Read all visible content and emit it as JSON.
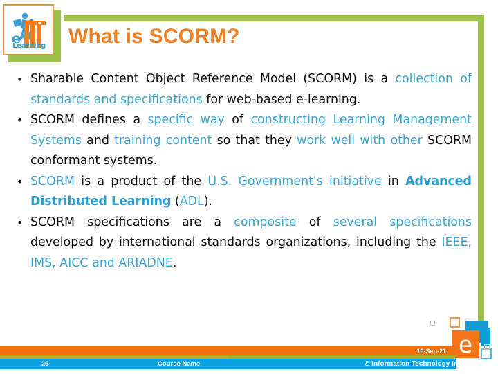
{
  "slide": {
    "title": "What is SCORM?",
    "accent_orange": "#ef7f22",
    "accent_green": "#9dc249",
    "accent_blue": "#3aa6d8"
  },
  "logo": {
    "name": "eITI Learning",
    "mark_e": "e",
    "mark_learning": "Learning"
  },
  "bullets": [
    {
      "runs": [
        {
          "text": "Sharable Content Object Reference Model (SCORM) is a ",
          "style": "plain"
        },
        {
          "text": "collection of standards and specifications",
          "style": "blue"
        },
        {
          "text": " for web-based e-learning.",
          "style": "plain"
        }
      ]
    },
    {
      "runs": [
        {
          "text": "SCORM defines a ",
          "style": "plain"
        },
        {
          "text": "specific way",
          "style": "blue"
        },
        {
          "text": " of ",
          "style": "plain"
        },
        {
          "text": "constructing Learning Management Systems",
          "style": "blue"
        },
        {
          "text": " and ",
          "style": "plain"
        },
        {
          "text": "training content",
          "style": "blue"
        },
        {
          "text": " so that they ",
          "style": "plain"
        },
        {
          "text": "work well with other",
          "style": "blue"
        },
        {
          "text": " SCORM conformant systems.",
          "style": "plain"
        }
      ]
    },
    {
      "runs": [
        {
          "text": "SCORM",
          "style": "blue"
        },
        {
          "text": " is a product of the ",
          "style": "plain"
        },
        {
          "text": "U.S. Government's initiative",
          "style": "blue"
        },
        {
          "text": " in ",
          "style": "plain"
        },
        {
          "text": "Advanced Distributed Learning",
          "style": "blue-bold"
        },
        {
          "text": " (",
          "style": "plain"
        },
        {
          "text": "ADL",
          "style": "blue"
        },
        {
          "text": ").",
          "style": "plain"
        }
      ]
    },
    {
      "runs": [
        {
          "text": "SCORM specifications are a ",
          "style": "plain"
        },
        {
          "text": "composite",
          "style": "blue"
        },
        {
          "text": " of ",
          "style": "plain"
        },
        {
          "text": "several specifications",
          "style": "blue"
        },
        {
          "text": " developed by international standards organizations, including the ",
          "style": "plain"
        },
        {
          "text": "IEEE, IMS, AICC and ARIADNE",
          "style": "blue"
        },
        {
          "text": ".",
          "style": "plain"
        }
      ]
    }
  ],
  "footer": {
    "page_number": "25",
    "course_name": "Course Name",
    "date": "10-Sep-21",
    "copyright": "© Information Technology Institute"
  },
  "brand_mark": {
    "letter": "e"
  }
}
